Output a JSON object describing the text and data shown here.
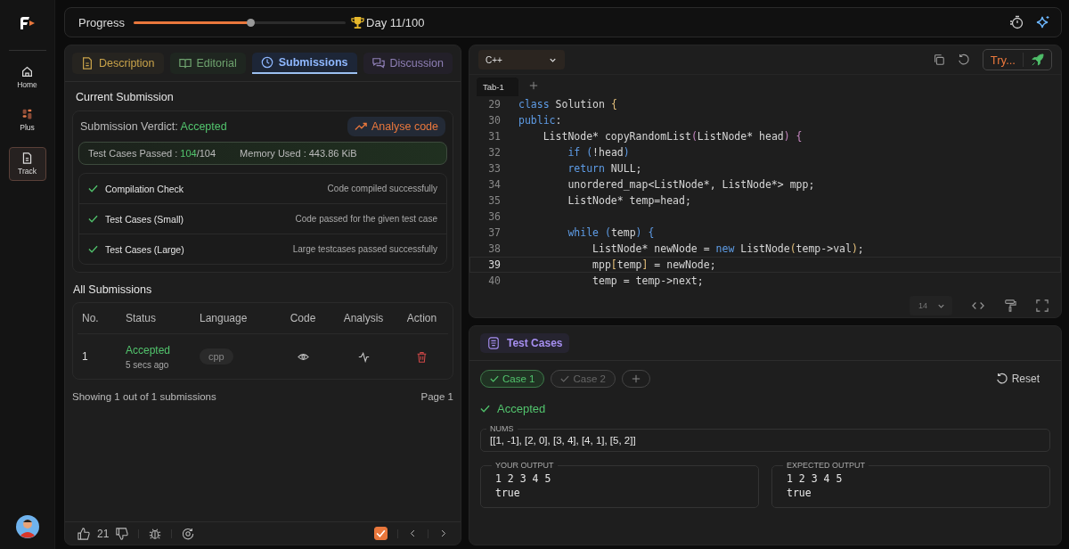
{
  "sidebar": {
    "items": [
      {
        "label": "Home",
        "selected": false
      },
      {
        "label": "Plus",
        "selected": false
      },
      {
        "label": "Track",
        "selected": true
      }
    ]
  },
  "progress": {
    "label": "Progress",
    "level": 0.55,
    "day": "Day 11/100"
  },
  "tabs": [
    {
      "label": "Description",
      "color": "#c9a34a",
      "selected": false
    },
    {
      "label": "Editorial",
      "color": "#6fa36f",
      "selected": false
    },
    {
      "label": "Submissions",
      "color": "#8fb8ff",
      "selected": true
    },
    {
      "label": "Discussion",
      "color": "#8e7fb5",
      "selected": false
    }
  ],
  "current_submission": {
    "title": "Current Submission",
    "verdict_label": "Submission Verdict:",
    "verdict": "Accepted",
    "analyse_button": "Analyse code",
    "tests_label": "Test Cases Passed :",
    "tests_passed": "104",
    "tests_total": "/104",
    "memory": "Memory Used : 443.86 KiB",
    "checks": [
      {
        "name": "Compilation Check",
        "detail": "Code compiled successfully",
        "passed": true
      },
      {
        "name": "Test Cases (Small)",
        "detail": "Code passed for the given test case",
        "passed": true
      },
      {
        "name": "Test Cases (Large)",
        "detail": "Large testcases passed successfully",
        "passed": true
      }
    ]
  },
  "all_submissions": {
    "title": "All Submissions",
    "columns": [
      "No.",
      "Status",
      "Language",
      "Code",
      "Analysis",
      "Action"
    ],
    "rows": [
      {
        "no": "1",
        "status": "Accepted",
        "time": "5 secs ago",
        "language": "cpp"
      }
    ],
    "footer": "Showing 1 out of 1 submissions",
    "page": "Page 1"
  },
  "bottom_bar": {
    "likes": "21",
    "checked": true
  },
  "editor": {
    "language": "C++",
    "run_button": "Try...",
    "tabs": [
      {
        "label": "Tab-1",
        "selected": true
      }
    ],
    "font_size": "14",
    "lines": [
      {
        "number": "29",
        "current": false,
        "tokens": [
          {
            "text": "class",
            "kind": "keyword"
          },
          {
            "text": " Solution ",
            "kind": "plain"
          },
          {
            "text": "{",
            "kind": "bracket"
          }
        ]
      },
      {
        "number": "30",
        "current": false,
        "tokens": [
          {
            "text": "public",
            "kind": "keyword"
          },
          {
            "text": ":",
            "kind": "plain"
          }
        ]
      },
      {
        "number": "31",
        "current": false,
        "tokens": [
          {
            "text": "    ListNode* copyRandomList",
            "kind": "plain"
          },
          {
            "text": "(",
            "kind": "paren"
          },
          {
            "text": "ListNode* head",
            "kind": "plain"
          },
          {
            "text": ")",
            "kind": "paren"
          },
          {
            "text": " {",
            "kind": "paren"
          }
        ]
      },
      {
        "number": "32",
        "current": false,
        "tokens": [
          {
            "text": "        if",
            "kind": "keyword"
          },
          {
            "text": " (",
            "kind": "keyword"
          },
          {
            "text": "!head",
            "kind": "plain"
          },
          {
            "text": ")",
            "kind": "keyword"
          }
        ]
      },
      {
        "number": "33",
        "current": false,
        "tokens": [
          {
            "text": "        return",
            "kind": "keyword"
          },
          {
            "text": " NULL;",
            "kind": "plain"
          }
        ]
      },
      {
        "number": "34",
        "current": false,
        "tokens": [
          {
            "text": "        unordered_map<ListNode*, ListNode*> mpp;",
            "kind": "plain"
          }
        ]
      },
      {
        "number": "35",
        "current": false,
        "tokens": [
          {
            "text": "        ListNode* temp=head;",
            "kind": "plain"
          }
        ]
      },
      {
        "number": "36",
        "current": false
      },
      {
        "number": "37",
        "current": false,
        "tokens": [
          {
            "text": "        while",
            "kind": "keyword"
          },
          {
            "text": " (",
            "kind": "keyword"
          },
          {
            "text": "temp",
            "kind": "plain"
          },
          {
            "text": ")",
            "kind": "keyword"
          },
          {
            "text": " {",
            "kind": "keyword"
          }
        ]
      },
      {
        "number": "38",
        "current": false,
        "tokens": [
          {
            "text": "            ListNode* newNode = ",
            "kind": "plain"
          },
          {
            "text": "new",
            "kind": "keyword"
          },
          {
            "text": " ListNode",
            "kind": "plain"
          },
          {
            "text": "(",
            "kind": "bracket"
          },
          {
            "text": "temp->val",
            "kind": "plain"
          },
          {
            "text": ")",
            "kind": "bracket"
          },
          {
            "text": ";",
            "kind": "plain"
          }
        ]
      },
      {
        "number": "39",
        "current": true,
        "tokens": [
          {
            "text": "            mpp",
            "kind": "plain"
          },
          {
            "text": "[",
            "kind": "bracket"
          },
          {
            "text": "temp",
            "kind": "plain"
          },
          {
            "text": "]",
            "kind": "bracket"
          },
          {
            "text": " = newNode;",
            "kind": "plain"
          }
        ]
      },
      {
        "number": "40",
        "current": false,
        "tokens": [
          {
            "text": "            temp = temp->next;",
            "kind": "plain"
          }
        ]
      }
    ]
  },
  "test_cases": {
    "title": "Test Cases",
    "cases": [
      {
        "label": "Case 1",
        "selected": true
      },
      {
        "label": "Case 2",
        "selected": false
      }
    ],
    "reset": "Reset",
    "result": "Accepted",
    "input_label": "NUMS",
    "input": "[[1, -1], [2, 0], [3, 4], [4, 1], [5, 2]]",
    "outputs": [
      {
        "label": "YOUR OUTPUT",
        "lines": [
          "1 2 3 4 5",
          "true"
        ]
      },
      {
        "label": "EXPECTED OUTPUT",
        "lines": [
          "1 2 3 4 5",
          "true"
        ]
      }
    ]
  }
}
